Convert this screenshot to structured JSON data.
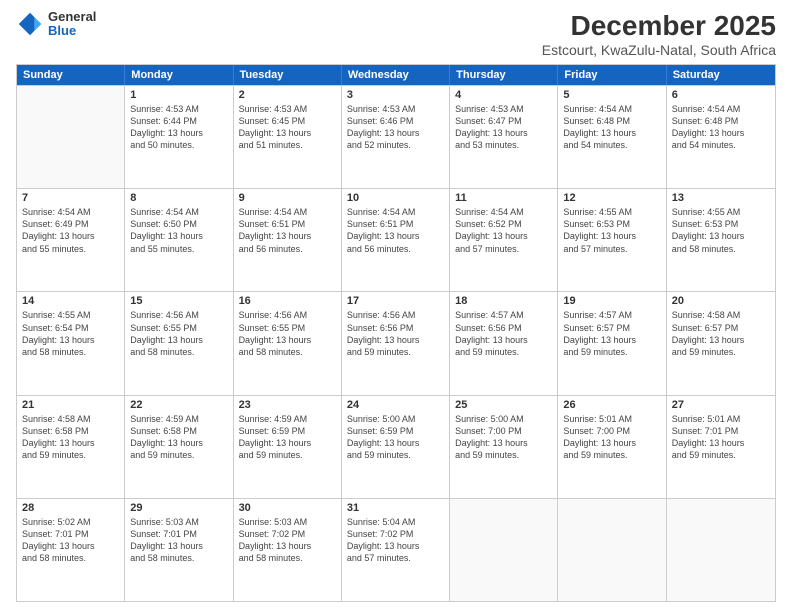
{
  "logo": {
    "general": "General",
    "blue": "Blue"
  },
  "title": "December 2025",
  "subtitle": "Estcourt, KwaZulu-Natal, South Africa",
  "header_days": [
    "Sunday",
    "Monday",
    "Tuesday",
    "Wednesday",
    "Thursday",
    "Friday",
    "Saturday"
  ],
  "weeks": [
    [
      {
        "day": "",
        "text": ""
      },
      {
        "day": "1",
        "text": "Sunrise: 4:53 AM\nSunset: 6:44 PM\nDaylight: 13 hours\nand 50 minutes."
      },
      {
        "day": "2",
        "text": "Sunrise: 4:53 AM\nSunset: 6:45 PM\nDaylight: 13 hours\nand 51 minutes."
      },
      {
        "day": "3",
        "text": "Sunrise: 4:53 AM\nSunset: 6:46 PM\nDaylight: 13 hours\nand 52 minutes."
      },
      {
        "day": "4",
        "text": "Sunrise: 4:53 AM\nSunset: 6:47 PM\nDaylight: 13 hours\nand 53 minutes."
      },
      {
        "day": "5",
        "text": "Sunrise: 4:54 AM\nSunset: 6:48 PM\nDaylight: 13 hours\nand 54 minutes."
      },
      {
        "day": "6",
        "text": "Sunrise: 4:54 AM\nSunset: 6:48 PM\nDaylight: 13 hours\nand 54 minutes."
      }
    ],
    [
      {
        "day": "7",
        "text": "Sunrise: 4:54 AM\nSunset: 6:49 PM\nDaylight: 13 hours\nand 55 minutes."
      },
      {
        "day": "8",
        "text": "Sunrise: 4:54 AM\nSunset: 6:50 PM\nDaylight: 13 hours\nand 55 minutes."
      },
      {
        "day": "9",
        "text": "Sunrise: 4:54 AM\nSunset: 6:51 PM\nDaylight: 13 hours\nand 56 minutes."
      },
      {
        "day": "10",
        "text": "Sunrise: 4:54 AM\nSunset: 6:51 PM\nDaylight: 13 hours\nand 56 minutes."
      },
      {
        "day": "11",
        "text": "Sunrise: 4:54 AM\nSunset: 6:52 PM\nDaylight: 13 hours\nand 57 minutes."
      },
      {
        "day": "12",
        "text": "Sunrise: 4:55 AM\nSunset: 6:53 PM\nDaylight: 13 hours\nand 57 minutes."
      },
      {
        "day": "13",
        "text": "Sunrise: 4:55 AM\nSunset: 6:53 PM\nDaylight: 13 hours\nand 58 minutes."
      }
    ],
    [
      {
        "day": "14",
        "text": "Sunrise: 4:55 AM\nSunset: 6:54 PM\nDaylight: 13 hours\nand 58 minutes."
      },
      {
        "day": "15",
        "text": "Sunrise: 4:56 AM\nSunset: 6:55 PM\nDaylight: 13 hours\nand 58 minutes."
      },
      {
        "day": "16",
        "text": "Sunrise: 4:56 AM\nSunset: 6:55 PM\nDaylight: 13 hours\nand 58 minutes."
      },
      {
        "day": "17",
        "text": "Sunrise: 4:56 AM\nSunset: 6:56 PM\nDaylight: 13 hours\nand 59 minutes."
      },
      {
        "day": "18",
        "text": "Sunrise: 4:57 AM\nSunset: 6:56 PM\nDaylight: 13 hours\nand 59 minutes."
      },
      {
        "day": "19",
        "text": "Sunrise: 4:57 AM\nSunset: 6:57 PM\nDaylight: 13 hours\nand 59 minutes."
      },
      {
        "day": "20",
        "text": "Sunrise: 4:58 AM\nSunset: 6:57 PM\nDaylight: 13 hours\nand 59 minutes."
      }
    ],
    [
      {
        "day": "21",
        "text": "Sunrise: 4:58 AM\nSunset: 6:58 PM\nDaylight: 13 hours\nand 59 minutes."
      },
      {
        "day": "22",
        "text": "Sunrise: 4:59 AM\nSunset: 6:58 PM\nDaylight: 13 hours\nand 59 minutes."
      },
      {
        "day": "23",
        "text": "Sunrise: 4:59 AM\nSunset: 6:59 PM\nDaylight: 13 hours\nand 59 minutes."
      },
      {
        "day": "24",
        "text": "Sunrise: 5:00 AM\nSunset: 6:59 PM\nDaylight: 13 hours\nand 59 minutes."
      },
      {
        "day": "25",
        "text": "Sunrise: 5:00 AM\nSunset: 7:00 PM\nDaylight: 13 hours\nand 59 minutes."
      },
      {
        "day": "26",
        "text": "Sunrise: 5:01 AM\nSunset: 7:00 PM\nDaylight: 13 hours\nand 59 minutes."
      },
      {
        "day": "27",
        "text": "Sunrise: 5:01 AM\nSunset: 7:01 PM\nDaylight: 13 hours\nand 59 minutes."
      }
    ],
    [
      {
        "day": "28",
        "text": "Sunrise: 5:02 AM\nSunset: 7:01 PM\nDaylight: 13 hours\nand 58 minutes."
      },
      {
        "day": "29",
        "text": "Sunrise: 5:03 AM\nSunset: 7:01 PM\nDaylight: 13 hours\nand 58 minutes."
      },
      {
        "day": "30",
        "text": "Sunrise: 5:03 AM\nSunset: 7:02 PM\nDaylight: 13 hours\nand 58 minutes."
      },
      {
        "day": "31",
        "text": "Sunrise: 5:04 AM\nSunset: 7:02 PM\nDaylight: 13 hours\nand 57 minutes."
      },
      {
        "day": "",
        "text": ""
      },
      {
        "day": "",
        "text": ""
      },
      {
        "day": "",
        "text": ""
      }
    ]
  ]
}
